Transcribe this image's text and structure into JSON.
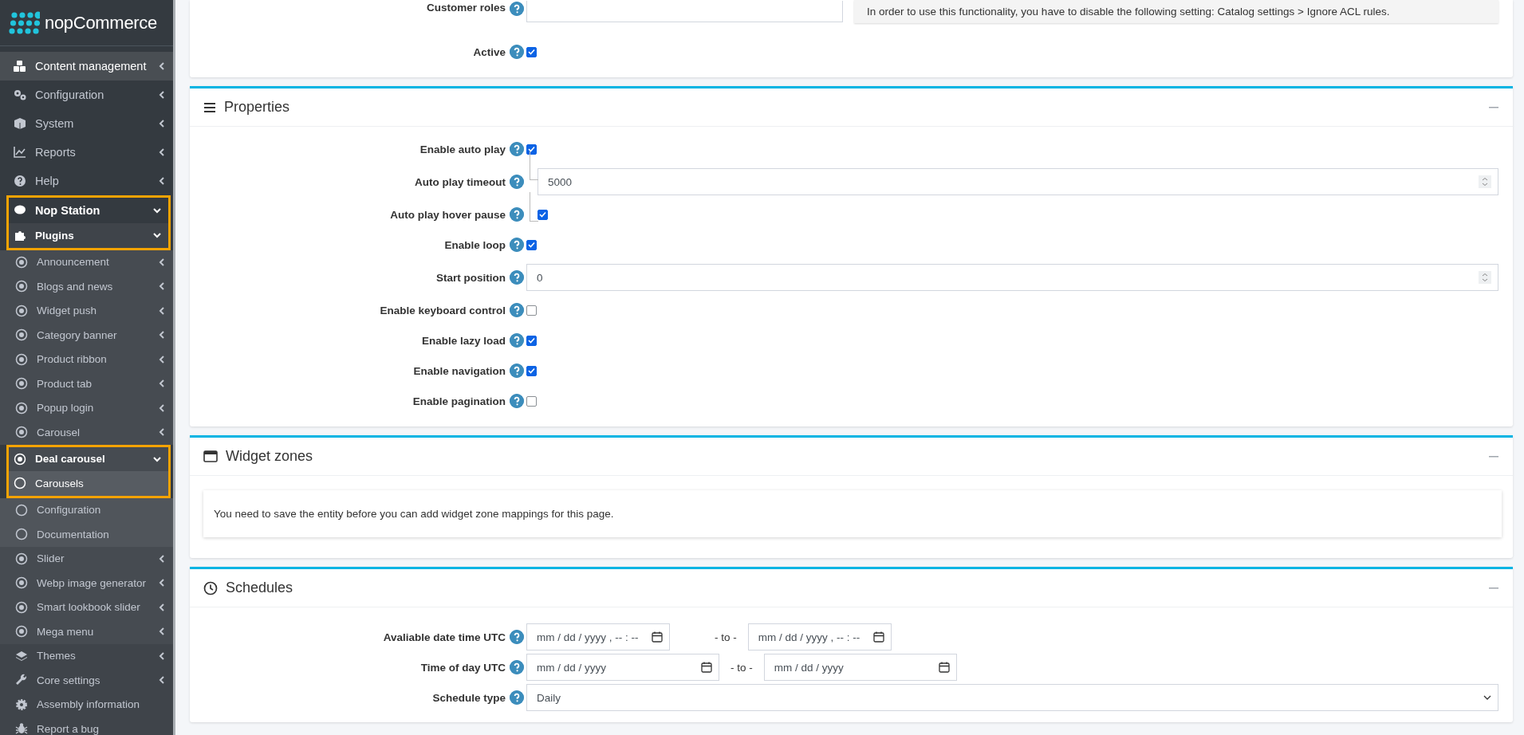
{
  "sidebar": {
    "logo": "nopCommerce",
    "items": [
      {
        "label": "Content management",
        "expanded": false,
        "selected": true
      },
      {
        "label": "Configuration",
        "expanded": false,
        "selected": false
      },
      {
        "label": "System",
        "expanded": false,
        "selected": false
      },
      {
        "label": "Reports",
        "expanded": false,
        "selected": false
      },
      {
        "label": "Help",
        "expanded": false,
        "selected": false
      },
      {
        "label": "Nop Station",
        "expanded": true,
        "selected": false,
        "highlighted": true,
        "children": [
          {
            "label": "Plugins",
            "expanded": true,
            "selected": false,
            "highlighted": true,
            "children": [
              {
                "label": "Announcement",
                "expanded": false,
                "selected": false
              },
              {
                "label": "Blogs and news",
                "expanded": false,
                "selected": false
              },
              {
                "label": "Widget push",
                "expanded": false,
                "selected": false
              },
              {
                "label": "Category banner",
                "expanded": false,
                "selected": false
              },
              {
                "label": "Product ribbon",
                "expanded": false,
                "selected": false
              },
              {
                "label": "Product tab",
                "expanded": false,
                "selected": false
              },
              {
                "label": "Popup login",
                "expanded": false,
                "selected": false
              },
              {
                "label": "Carousel",
                "expanded": false,
                "selected": false
              },
              {
                "label": "Deal carousel",
                "expanded": true,
                "selected": false,
                "highlighted": true,
                "children": [
                  {
                    "label": "Carousels",
                    "selected": true,
                    "highlighted": true
                  },
                  {
                    "label": "Configuration",
                    "selected": false
                  },
                  {
                    "label": "Documentation",
                    "selected": false
                  }
                ]
              },
              {
                "label": "Slider",
                "expanded": false,
                "selected": false
              },
              {
                "label": "Webp image generator",
                "expanded": false,
                "selected": false
              },
              {
                "label": "Smart lookbook slider",
                "expanded": false,
                "selected": false
              },
              {
                "label": "Mega menu",
                "expanded": false,
                "selected": false
              }
            ]
          },
          {
            "label": "Themes",
            "expanded": false,
            "selected": false
          },
          {
            "label": "Core settings",
            "expanded": false,
            "selected": false
          },
          {
            "label": "Assembly information",
            "selected": false
          },
          {
            "label": "Report a bug",
            "selected": false
          }
        ]
      }
    ]
  },
  "access": {
    "rows": [
      {
        "kind": "roles",
        "label": "Customer roles",
        "notice": "In order to use this functionality, you have to disable the following setting: Catalog settings > Ignore ACL rules."
      },
      {
        "kind": "checkbox",
        "label": "Active",
        "checked": true
      }
    ]
  },
  "properties": {
    "title": "Properties",
    "rows": [
      {
        "kind": "checkbox",
        "label": "Enable auto play",
        "checked": true,
        "children": [
          {
            "kind": "number",
            "label": "Auto play timeout",
            "value": "5000"
          },
          {
            "kind": "checkbox",
            "label": "Auto play hover pause",
            "checked": true
          }
        ]
      },
      {
        "kind": "checkbox",
        "label": "Enable loop",
        "checked": true
      },
      {
        "kind": "number",
        "label": "Start position",
        "value": "0"
      },
      {
        "kind": "checkbox",
        "label": "Enable keyboard control",
        "checked": false
      },
      {
        "kind": "checkbox",
        "label": "Enable lazy load",
        "checked": true
      },
      {
        "kind": "checkbox",
        "label": "Enable navigation",
        "checked": true
      },
      {
        "kind": "checkbox",
        "label": "Enable pagination",
        "checked": false
      }
    ]
  },
  "widget_zones": {
    "title": "Widget zones",
    "message": "You need to save the entity before you can add widget zone mappings for this page."
  },
  "schedules": {
    "title": "Schedules",
    "rows": [
      {
        "kind": "datetime-range",
        "label": "Avaliable date time UTC",
        "from_placeholder": "mm / dd / yyyy ,  -- : --",
        "separator": "- to -",
        "to_placeholder": "mm / dd / yyyy ,  -- : --"
      },
      {
        "kind": "date-range",
        "label": "Time of day UTC",
        "from_placeholder": "mm / dd / yyyy",
        "separator": "- to -",
        "to_placeholder": "mm / dd / yyyy"
      },
      {
        "kind": "select",
        "label": "Schedule type",
        "value": "Daily"
      }
    ]
  }
}
